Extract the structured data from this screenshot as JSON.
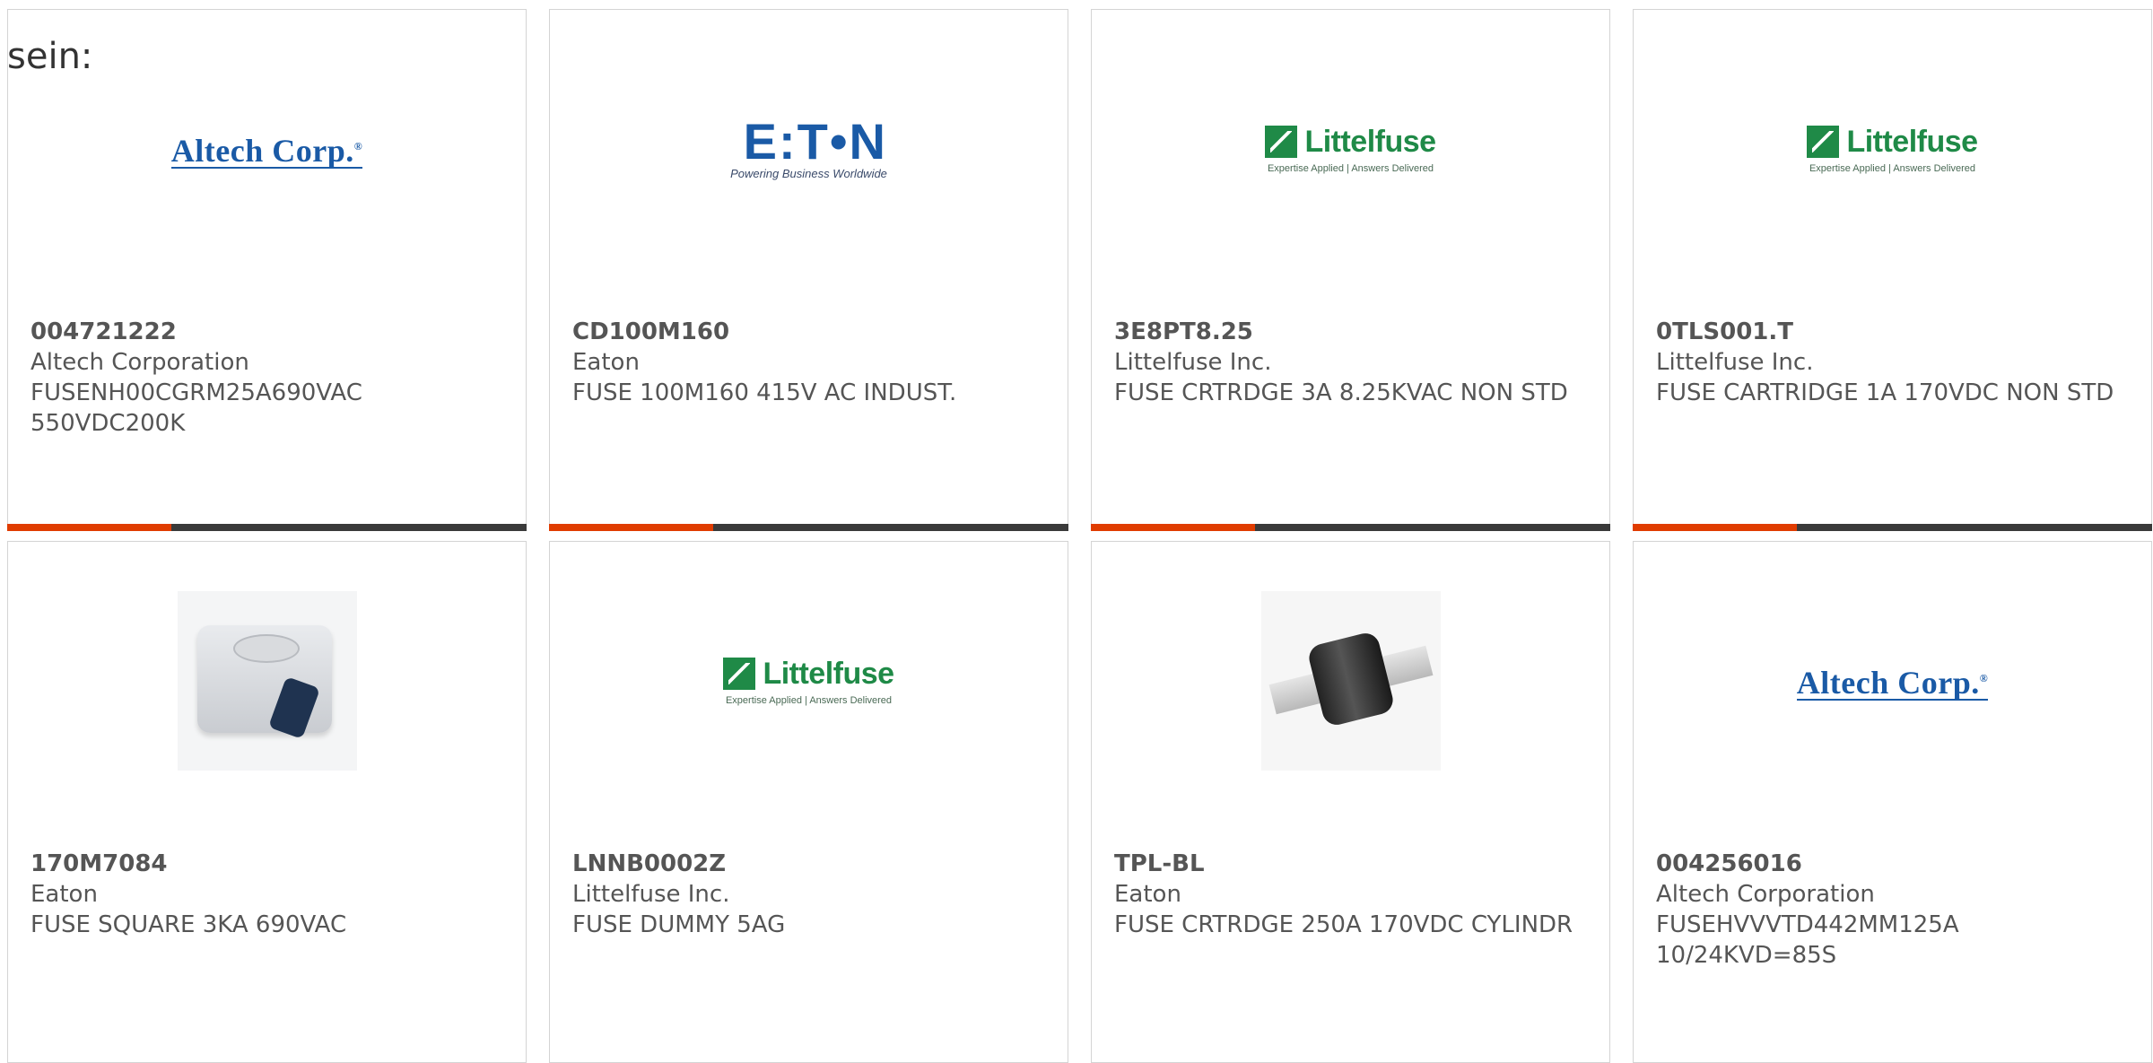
{
  "intro_text": "sein:",
  "colors": {
    "accent": "#e03c00",
    "bar": "#3a3a3a",
    "border": "#d4d4d4",
    "text": "#555555"
  },
  "cards": [
    {
      "part": "004721222",
      "manufacturer": "Altech Corporation",
      "description": "FUSENH00CGRM25A690VAC 550VDC200K",
      "logo": {
        "type": "altech",
        "text": "Altech Corp.",
        "sup": "®"
      }
    },
    {
      "part": "CD100M160",
      "manufacturer": "Eaton",
      "description": "FUSE 100M160 415V AC INDUST.",
      "logo": {
        "type": "eaton",
        "text": "E:T•N",
        "tag": "Powering Business Worldwide"
      }
    },
    {
      "part": "3E8PT8.25",
      "manufacturer": "Littelfuse Inc.",
      "description": "FUSE CRTRDGE 3A 8.25KVAC NON STD",
      "logo": {
        "type": "littelfuse",
        "text": "Littelfuse",
        "tag": "Expertise Applied | Answers Delivered"
      }
    },
    {
      "part": "0TLS001.T",
      "manufacturer": "Littelfuse Inc.",
      "description": "FUSE CARTRIDGE 1A 170VDC NON STD",
      "logo": {
        "type": "littelfuse",
        "text": "Littelfuse",
        "tag": "Expertise Applied | Answers Delivered"
      }
    },
    {
      "part": "170M7084",
      "manufacturer": "Eaton",
      "description": "FUSE SQUARE 3KA 690VAC",
      "logo": {
        "type": "product-square-fuse"
      }
    },
    {
      "part": "LNNB0002Z",
      "manufacturer": "Littelfuse Inc.",
      "description": "FUSE DUMMY 5AG",
      "logo": {
        "type": "littelfuse",
        "text": "Littelfuse",
        "tag": "Expertise Applied | Answers Delivered"
      }
    },
    {
      "part": "TPL-BL",
      "manufacturer": "Eaton",
      "description": "FUSE CRTRDGE 250A 170VDC CYLINDR",
      "logo": {
        "type": "product-cylinder-fuse"
      }
    },
    {
      "part": "004256016",
      "manufacturer": "Altech Corporation",
      "description": "FUSEHVVVTD442MM125A 10/24KVD=85S",
      "logo": {
        "type": "altech",
        "text": "Altech Corp.",
        "sup": "®"
      }
    }
  ]
}
